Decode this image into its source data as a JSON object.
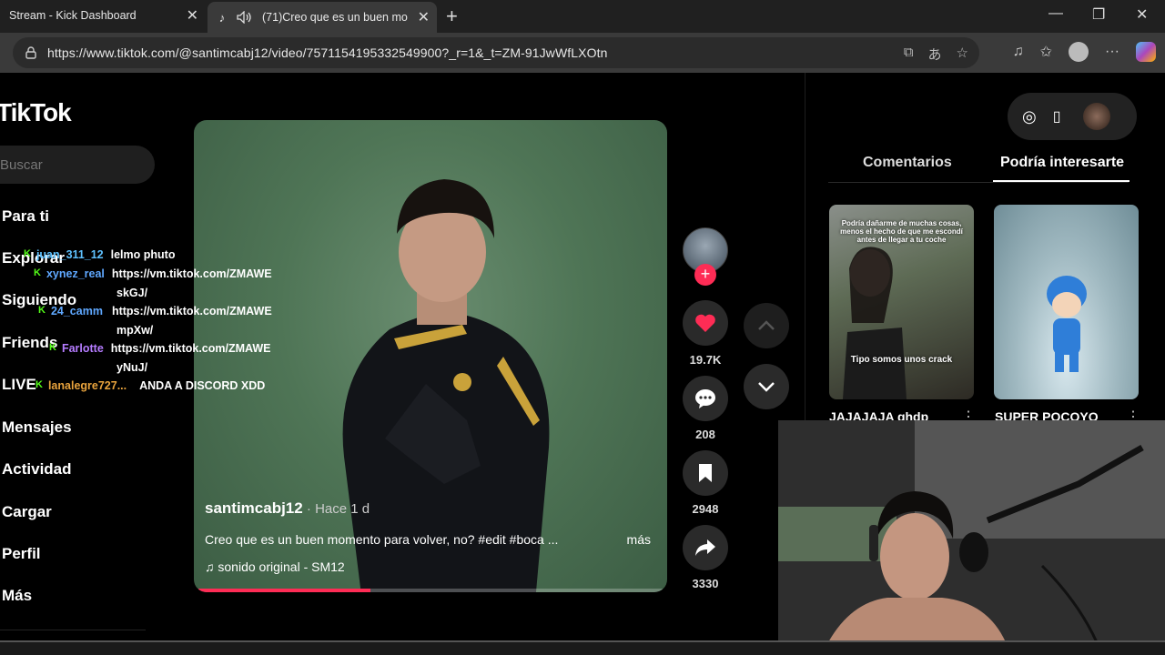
{
  "browser": {
    "tabs": [
      {
        "title": "Stream - Kick Dashboard"
      },
      {
        "title": "(71)Creo que es un buen mo"
      }
    ],
    "url": "https://www.tiktok.com/@santimcabj12/video/7571154195332549900?_r=1&_t=ZM-91JwWfLXOtn"
  },
  "sidebar": {
    "logo": "TikTok",
    "search_placeholder": "Buscar",
    "items": [
      "Para ti",
      "Explorar",
      "Siguiendo",
      "Friends",
      "LIVE",
      "Mensajes",
      "Actividad",
      "Cargar",
      "Perfil",
      "Más"
    ]
  },
  "chat": [
    {
      "user": "juan_311_12",
      "color": "#5fc2ff",
      "msg": "lelmo phuto"
    },
    {
      "user": "xynez_real",
      "color": "#5fa8ff",
      "msg": "https://vm.tiktok.com/ZMAWE",
      "msg2": "skGJ/"
    },
    {
      "user": "24_camm",
      "color": "#5fa8ff",
      "msg": "https://vm.tiktok.com/ZMAWE",
      "msg2": "mpXw/"
    },
    {
      "user": "Farlotte",
      "color": "#b57cff",
      "msg": "https://vm.tiktok.com/ZMAWE",
      "msg2": "yNuJ/"
    },
    {
      "user": "lanalegre727...",
      "color": "#e8a33d",
      "msg": "ANDA A DISCORD XDD"
    }
  ],
  "video": {
    "author": "santimcabj12",
    "time": " · Hace 1 d",
    "caption": "Creo que es un buen momento para volver, no? #edit #boca ...",
    "more": "más",
    "sound": "sonido original - SM12",
    "progress": 0.37
  },
  "actions": {
    "likes": "19.7K",
    "comments": "208",
    "saves": "2948",
    "shares": "3330"
  },
  "right_panel": {
    "tabs": [
      "Comentarios",
      "Podría interesarte"
    ],
    "active_tab": 1,
    "cards": [
      {
        "title": "JAJAJAJA ghdp",
        "overlay_top": "Podría dañarme de muchas cosas, menos el hecho de que me escondí antes de llegar a tu coche",
        "overlay_bottom": "Tipo somos unos crack"
      },
      {
        "title": "SUPER POCOYO"
      }
    ]
  },
  "colors": {
    "accent": "#fe2c55",
    "kick_green": "#53fc18"
  }
}
